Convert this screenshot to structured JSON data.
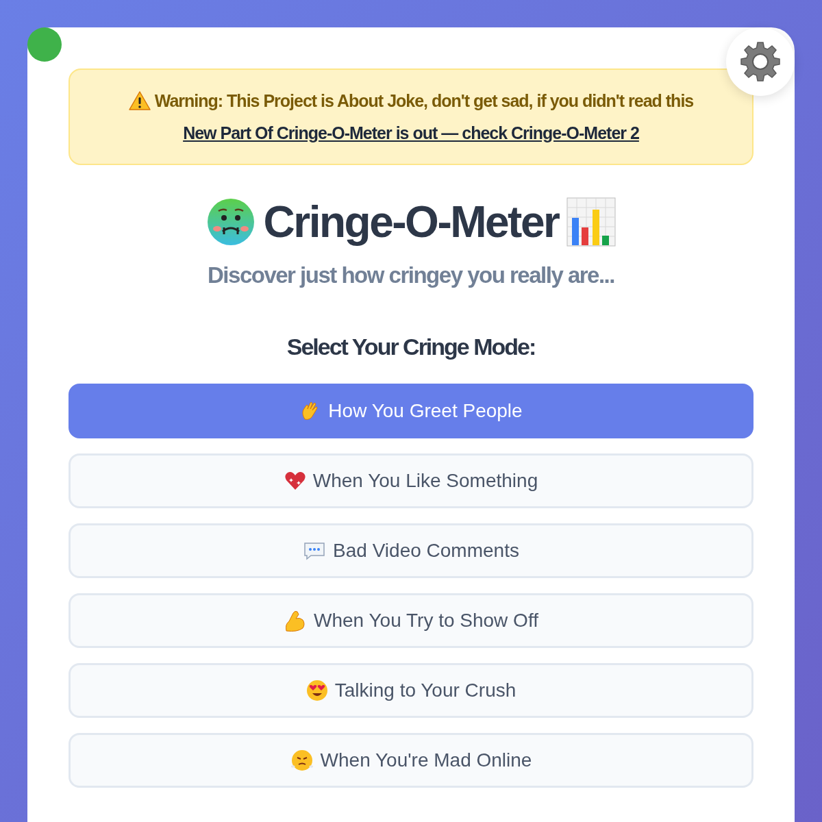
{
  "warning": {
    "text": "**Warning:** This Project is About Joke, don't get sad, if you didn't read this",
    "link": "New Part Of Cringe-O-Meter is out — check Cringe-O-Meter 2"
  },
  "title": "Cringe-O-Meter",
  "subtitle": "Discover just how cringey you really are...",
  "section_heading": "Select Your Cringe Mode:",
  "modes": [
    {
      "label": "How You Greet People",
      "selected": true
    },
    {
      "label": "When You Like Something",
      "selected": false
    },
    {
      "label": "Bad Video Comments",
      "selected": false
    },
    {
      "label": "When You Try to Show Off",
      "selected": false
    },
    {
      "label": "Talking to Your Crush",
      "selected": false
    },
    {
      "label": "When You're Mad Online",
      "selected": false
    }
  ]
}
